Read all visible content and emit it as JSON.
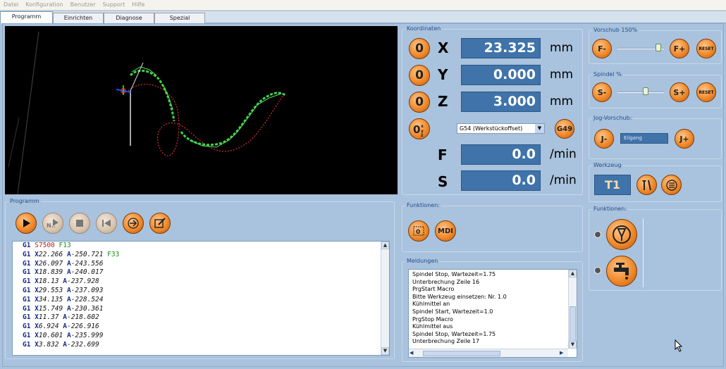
{
  "menu": [
    "Datei",
    "Konfiguration",
    "Benutzer",
    "Support",
    "Hilfe"
  ],
  "tabs": [
    "Programm",
    "Einrichten",
    "Diagnose",
    "Spezial"
  ],
  "program_panel": {
    "title": "Programm"
  },
  "code_lines": [
    {
      "g": "G1",
      "rest": [
        {
          "t": " S7500 ",
          "c": "red"
        },
        {
          "t": "F13",
          "c": "grn"
        }
      ]
    },
    {
      "g": "G1",
      "rest": [
        {
          "t": " X",
          "c": "kw"
        },
        {
          "t": "22.266 "
        },
        {
          "t": "A",
          "c": "kw"
        },
        {
          "t": "-250.721 "
        },
        {
          "t": "F33",
          "c": "grn"
        }
      ]
    },
    {
      "g": "G1",
      "rest": [
        {
          "t": " X",
          "c": "kw"
        },
        {
          "t": "26.097 "
        },
        {
          "t": "A",
          "c": "kw"
        },
        {
          "t": "-243.556"
        }
      ]
    },
    {
      "g": "G1",
      "rest": [
        {
          "t": " X",
          "c": "kw"
        },
        {
          "t": "18.839 "
        },
        {
          "t": "A",
          "c": "kw"
        },
        {
          "t": "-240.017"
        }
      ]
    },
    {
      "g": "G1",
      "rest": [
        {
          "t": " X",
          "c": "kw"
        },
        {
          "t": "18.13 "
        },
        {
          "t": "A",
          "c": "kw"
        },
        {
          "t": "-237.928"
        }
      ]
    },
    {
      "g": "G1",
      "rest": [
        {
          "t": " X",
          "c": "kw"
        },
        {
          "t": "29.553 "
        },
        {
          "t": "A",
          "c": "kw"
        },
        {
          "t": "-237.093"
        }
      ]
    },
    {
      "g": "G1",
      "rest": [
        {
          "t": " X",
          "c": "kw"
        },
        {
          "t": "34.135 "
        },
        {
          "t": "A",
          "c": "kw"
        },
        {
          "t": "-228.524"
        }
      ]
    },
    {
      "g": "G1",
      "rest": [
        {
          "t": " X",
          "c": "kw"
        },
        {
          "t": "15.749 "
        },
        {
          "t": "A",
          "c": "kw"
        },
        {
          "t": "-230.361"
        }
      ]
    },
    {
      "g": "G1",
      "rest": [
        {
          "t": " X",
          "c": "kw"
        },
        {
          "t": "11.37 "
        },
        {
          "t": "A",
          "c": "kw"
        },
        {
          "t": "-218.602"
        }
      ]
    },
    {
      "g": "G1",
      "rest": [
        {
          "t": " X",
          "c": "kw"
        },
        {
          "t": "6.924 "
        },
        {
          "t": "A",
          "c": "kw"
        },
        {
          "t": "-226.916"
        }
      ]
    },
    {
      "g": "G1",
      "rest": [
        {
          "t": " X",
          "c": "kw"
        },
        {
          "t": "10.601 "
        },
        {
          "t": "A",
          "c": "kw"
        },
        {
          "t": "-235.999"
        }
      ]
    },
    {
      "g": "G1",
      "rest": [
        {
          "t": " X",
          "c": "kw"
        },
        {
          "t": "3.832 "
        },
        {
          "t": "A",
          "c": "kw"
        },
        {
          "t": "-232.699"
        }
      ]
    }
  ],
  "coords": {
    "title": "Koordinaten",
    "x": {
      "label": "X",
      "value": "23.325",
      "unit": "mm",
      "zero": "0"
    },
    "y": {
      "label": "Y",
      "value": "0.000",
      "unit": "mm",
      "zero": "0"
    },
    "z": {
      "label": "Z",
      "value": "3.000",
      "unit": "mm",
      "zero": "0"
    },
    "offset_select": "G54 (Werkstückoffset)",
    "g49": "G49",
    "f": {
      "label": "F",
      "value": "0.0",
      "unit": "/min"
    },
    "s": {
      "label": "S",
      "value": "0.0",
      "unit": "/min"
    }
  },
  "functions_mid": {
    "title": "Funktionen:",
    "mdi": "MDI"
  },
  "messages": {
    "title": "Meldungen",
    "lines": [
      "Spindel Stop, Wartezeit=1.75",
      "Unterbrechung Zeile 16",
      "PrgStart Macro",
      "Bitte Werkzeug einsetzen: Nr. 1.0",
      "Kühlmittel an",
      "Spindel Start, Wartezeit=1.0",
      "PrgStop Macro",
      "Kühlmittel aus",
      "Spindel Stop, Wartezeit=1.75",
      "Unterbrechung Zeile 17"
    ]
  },
  "feed": {
    "title": "Vorschub 150%",
    "minus": "F-",
    "plus": "F+",
    "reset": "RESET",
    "level_fraction": 0.9
  },
  "spindle": {
    "title": "Spindel %",
    "minus": "S-",
    "plus": "S+",
    "reset": "RESET",
    "level_fraction": 0.6
  },
  "jog": {
    "title": "Jog-Vorschub:",
    "minus": "J-",
    "plus": "J+",
    "mode": "Eilgang"
  },
  "tool": {
    "title": "Werkzeug",
    "current": "T1"
  },
  "functions_right": {
    "title": "Funktionen:"
  },
  "colors": {
    "accent_orange": "#f08a2a",
    "value_blue": "#3f73aa",
    "panel_bg": "#a9c2dd",
    "toolpath_green": "#3fd04a",
    "toolpath_red": "#d83030"
  }
}
